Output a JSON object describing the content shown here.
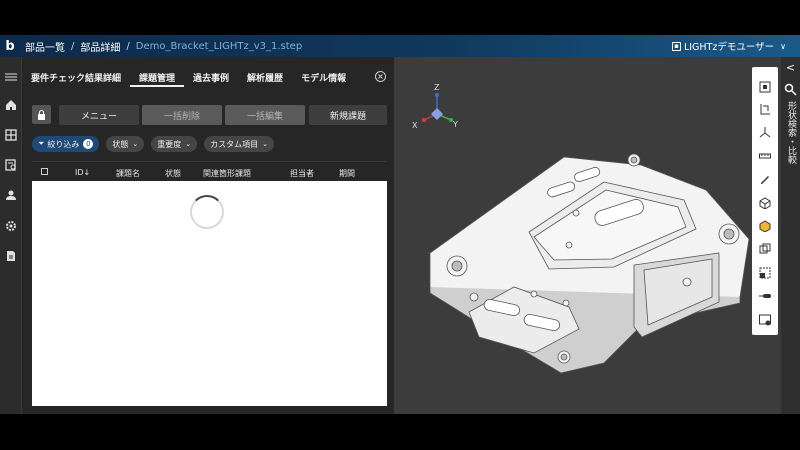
{
  "breadcrumb": {
    "items": [
      "部品一覧",
      "部品詳細"
    ],
    "separator": "/",
    "current": "Demo_Bracket_LIGHTz_v3_1.step"
  },
  "user": {
    "name": "LIGHTzデモユーザー",
    "caret": "∨"
  },
  "tabs": [
    {
      "label": "要件チェック結果詳細"
    },
    {
      "label": "課題管理",
      "active": true
    },
    {
      "label": "過去事例"
    },
    {
      "label": "解析履歴"
    },
    {
      "label": "モデル情報"
    }
  ],
  "actions": {
    "menu": "メニュー",
    "bulk_delete": "一括削除",
    "bulk_edit": "一括編集",
    "new_issue": "新規課題"
  },
  "filters": {
    "narrow_label": "絞り込み",
    "narrow_count": "0",
    "status": "状態",
    "severity": "重要度",
    "custom": "カスタム項目"
  },
  "table": {
    "columns": [
      "ID",
      "課題名",
      "状態",
      "関連箇形課題",
      "担当者",
      "期間"
    ],
    "sort_glyph": "↓",
    "loading": true
  },
  "right_rail": {
    "label": "形状検索・比較",
    "collapse_glyph": "<"
  },
  "axes": {
    "z": "Z",
    "x": "X",
    "y": "Y"
  },
  "colors": {
    "accent": "#1f4a78",
    "topbar": "#10385c",
    "viewport_bg": "#3c3c3c",
    "panel_bg": "#262626"
  },
  "icons": {
    "leftnav": [
      "menu-icon",
      "home-icon",
      "grid-icon",
      "report-icon",
      "user-icon",
      "settings-icon",
      "document-icon"
    ],
    "toolbar": [
      "fit-view-icon",
      "dimension-icon",
      "axis-icon",
      "ruler-icon",
      "pen-icon",
      "cube-icon",
      "solid-cube-icon",
      "wireframe-cube-icon",
      "section-icon",
      "probe-icon",
      "view-settings-icon"
    ]
  }
}
